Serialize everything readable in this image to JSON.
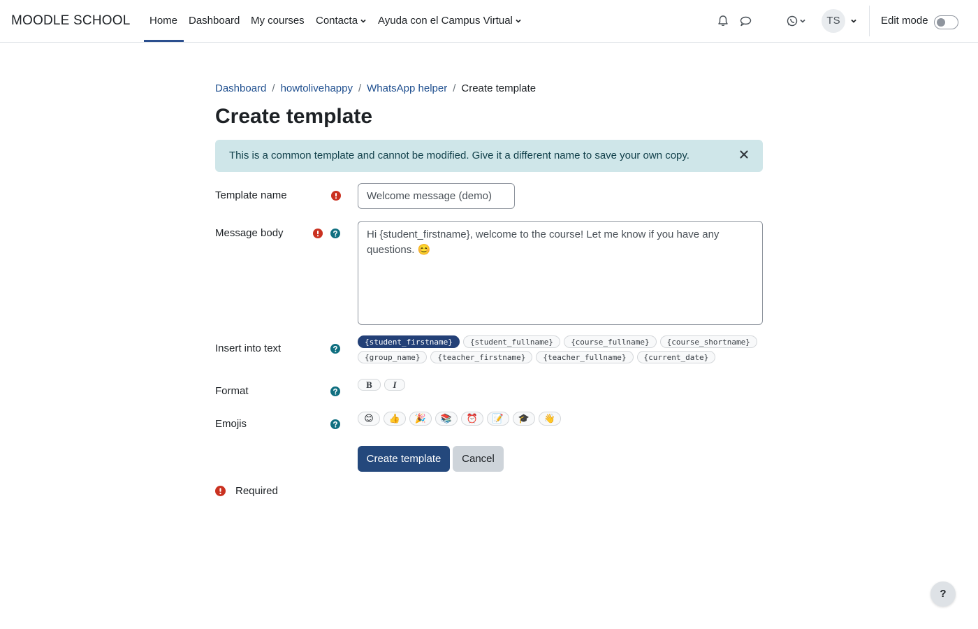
{
  "navbar": {
    "brand": "MOODLE SCHOOL",
    "items": [
      {
        "label": "Home"
      },
      {
        "label": "Dashboard"
      },
      {
        "label": "My courses"
      },
      {
        "label": "Contacta"
      },
      {
        "label": "Ayuda con el Campus Virtual"
      }
    ],
    "avatar_initials": "TS",
    "edit_mode_label": "Edit mode",
    "edit_mode_on": false,
    "icons": [
      "bell-icon",
      "chat-icon",
      "whatsapp-icon"
    ]
  },
  "breadcrumb": [
    "Dashboard",
    "howtolivehappy",
    "WhatsApp helper",
    "Create template"
  ],
  "page_title": "Create template",
  "alert": {
    "text": "This is a common template and cannot be modified. Give it a different name to save your own copy."
  },
  "form": {
    "template_name_label": "Template name",
    "template_name_value": "Welcome message (demo)",
    "message_body_label": "Message body",
    "message_body_value": "Hi {student_firstname}, welcome to the course! Let me know if you have any questions. 😊",
    "insert_label": "Insert into text",
    "placeholders": [
      "{student_firstname}",
      "{student_fullname}",
      "{course_fullname}",
      "{course_shortname}",
      "{group_name}",
      "{teacher_firstname}",
      "{teacher_fullname}",
      "{current_date}"
    ],
    "selected_placeholder": 0,
    "format_label": "Format",
    "format_buttons": [
      "B",
      "I"
    ],
    "emojis_label": "Emojis",
    "emojis": [
      "😊",
      "👍",
      "🎉",
      "📚",
      "⏰",
      "📝",
      "🎓",
      "👋"
    ],
    "submit_label": "Create template",
    "cancel_label": "Cancel",
    "required_text": "Required"
  },
  "help_fab": "?",
  "colors": {
    "primary": "#24487c",
    "link": "#1f4f8f",
    "alert_bg": "#cfe6e9",
    "required": "#ca3120",
    "help": "#0f6cbf"
  }
}
